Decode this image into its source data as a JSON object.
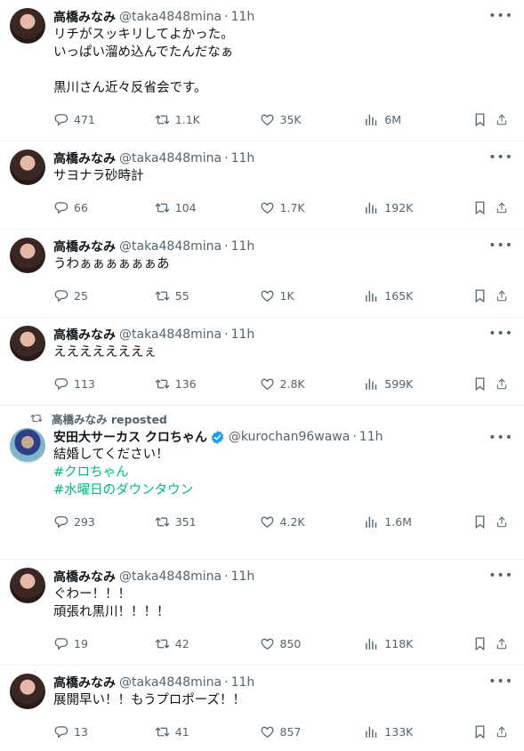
{
  "tweets": [
    {
      "name": "高橋みなみ",
      "handle": "@taka4848mina",
      "time": "11h",
      "text": "リチがスッキリしてよかった。\nいっぱい溜め込んでたんだなぁ\n\n黒川さん近々反省会です。",
      "replies": "471",
      "reposts": "1.1K",
      "likes": "35K",
      "views": "6M"
    },
    {
      "name": "高橋みなみ",
      "handle": "@taka4848mina",
      "time": "11h",
      "text": "サヨナラ砂時計",
      "replies": "66",
      "reposts": "104",
      "likes": "1.7K",
      "views": "192K"
    },
    {
      "name": "高橋みなみ",
      "handle": "@taka4848mina",
      "time": "11h",
      "text": "うわぁぁぁぁぁぁあ",
      "replies": "25",
      "reposts": "55",
      "likes": "1K",
      "views": "165K"
    },
    {
      "name": "高橋みなみ",
      "handle": "@taka4848mina",
      "time": "11h",
      "text": "えええええええぇ",
      "replies": "113",
      "reposts": "136",
      "likes": "2.8K",
      "views": "599K"
    },
    {
      "repost_label": "高橋みなみ reposted",
      "name": "安田大サーカス クロちゃん",
      "handle": "@kurochan96wawa",
      "time": "11h",
      "text": "結婚してください！\n",
      "hashtags": [
        "#クロちゃん",
        "#水曜日のダウンタウン"
      ],
      "replies": "293",
      "reposts": "351",
      "likes": "4.2K",
      "views": "1.6M"
    },
    {
      "name": "高橋みなみ",
      "handle": "@taka4848mina",
      "time": "11h",
      "text": "ぐわー！！！\n頑張れ黒川！！！！",
      "replies": "19",
      "reposts": "42",
      "likes": "850",
      "views": "118K"
    },
    {
      "name": "高橋みなみ",
      "handle": "@taka4848mina",
      "time": "11h",
      "text": "展開早い！！もうプロポーズ！！",
      "replies": "13",
      "reposts": "41",
      "likes": "857",
      "views": "133K"
    }
  ],
  "colors": {
    "text": "#0f1419",
    "muted": "#536471",
    "hashtag": "#00ba7c",
    "verified": "#1d9bf0",
    "divider": "#eff3f4"
  },
  "icons": [
    "more-icon",
    "reply-icon",
    "repost-icon",
    "like-icon",
    "views-icon",
    "bookmark-icon",
    "share-icon",
    "verified-icon"
  ]
}
